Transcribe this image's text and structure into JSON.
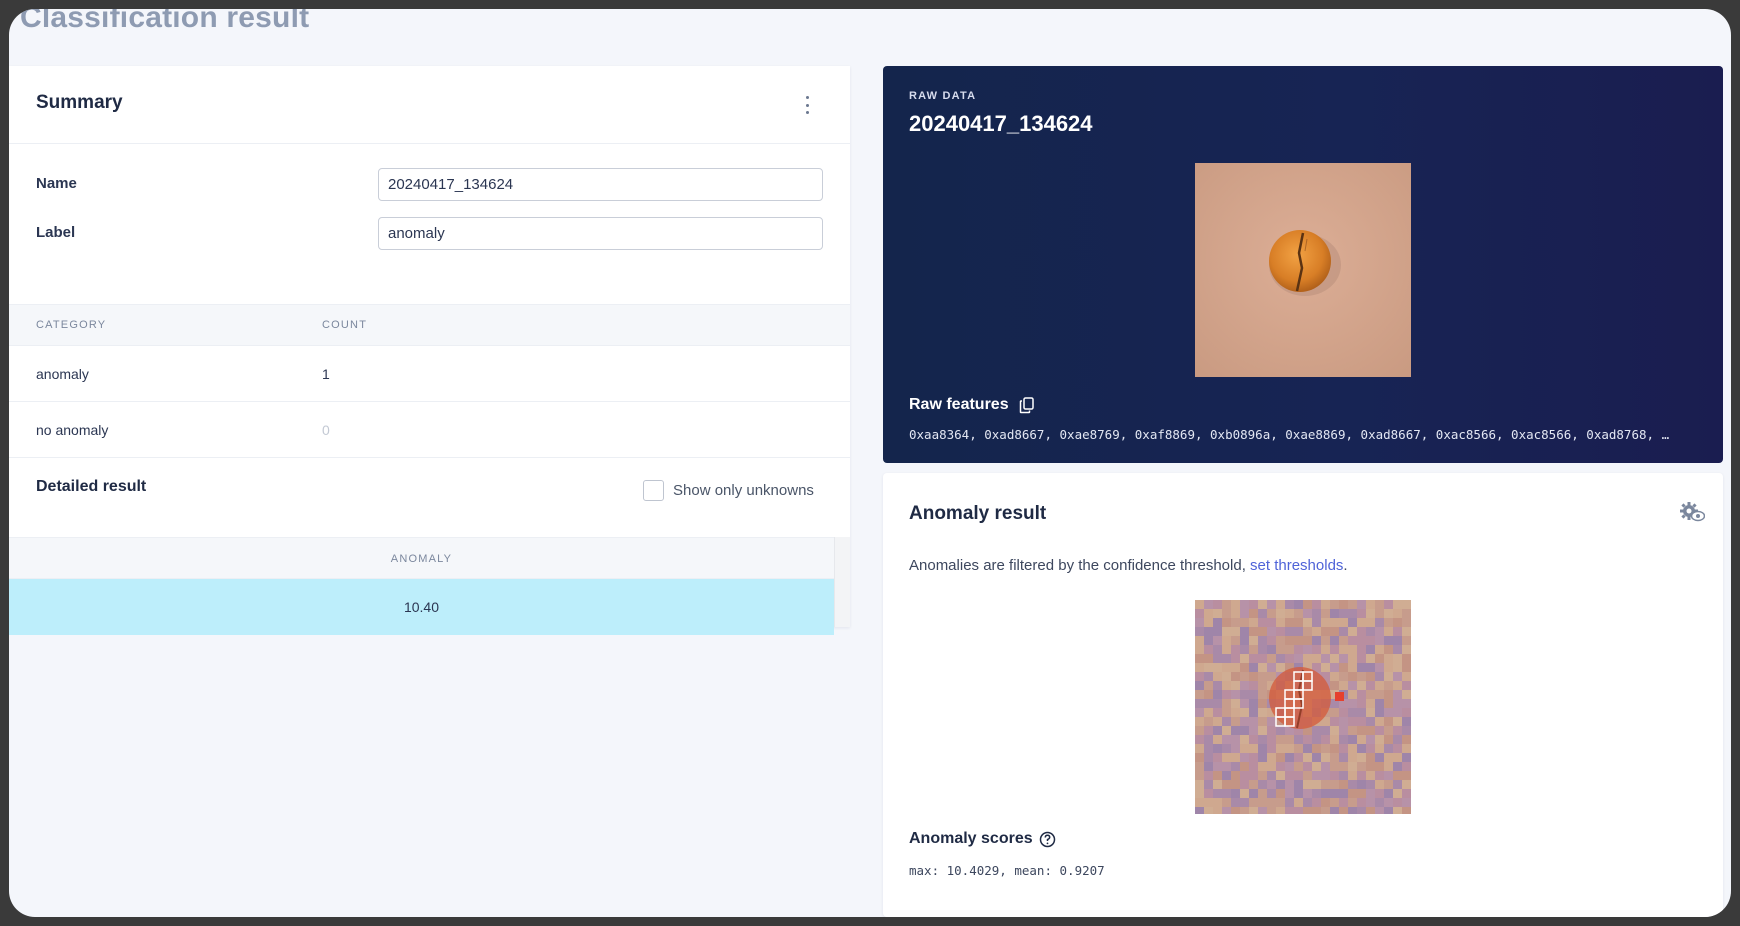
{
  "page": {
    "title": "Classification result"
  },
  "summary": {
    "title": "Summary",
    "name_label": "Name",
    "name_value": "20240417_134624",
    "label_label": "Label",
    "label_value": "anomaly",
    "table": {
      "headers": [
        "CATEGORY",
        "COUNT"
      ],
      "rows": [
        {
          "category": "anomaly",
          "count": "1"
        },
        {
          "category": "no anomaly",
          "count": "0"
        }
      ]
    }
  },
  "detailed": {
    "title": "Detailed result",
    "checkbox_label": "Show only unknowns",
    "checkbox_checked": false,
    "column": "ANOMALY",
    "value": "10.40"
  },
  "raw_data": {
    "eyebrow": "RAW DATA",
    "title": "20240417_134624",
    "features_title": "Raw features",
    "features": "0xaa8364, 0xad8667, 0xae8769, 0xaf8869, 0xb0896a, 0xae8869, 0xad8667, 0xac8566, 0xac8566, 0xad8768, …",
    "copy_icon": "copy-icon"
  },
  "anomaly": {
    "title": "Anomaly result",
    "description_prefix": "Anomalies are filtered by the confidence threshold, ",
    "link_text": "set thresholds",
    "description_suffix": ".",
    "scores_title": "Anomaly scores",
    "scores_text": "max: 10.4029, mean: 0.9207",
    "settings_icon": "gear-eye-icon",
    "help_icon": "help-circle-icon"
  },
  "colors": {
    "accent_link": "#4f63d8",
    "highlight_row": "#bdeefb",
    "raw_card_bg": "#172454"
  }
}
